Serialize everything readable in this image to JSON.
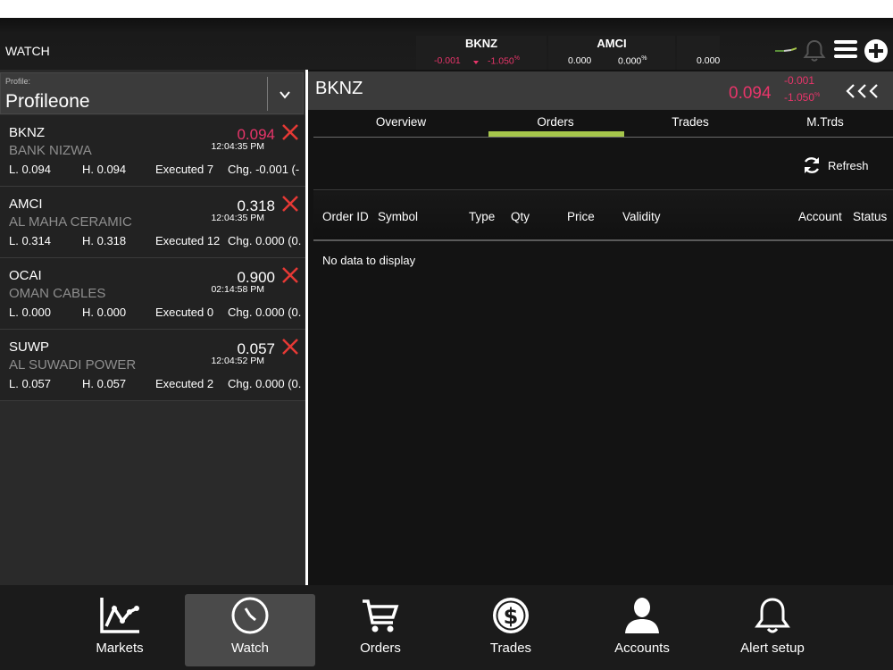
{
  "header": {
    "title": "WATCH",
    "tickers": [
      {
        "symbol": "BKNZ",
        "change": "-0.001",
        "pct": "-1.050",
        "pct_unit": "%"
      },
      {
        "symbol": "AMCI",
        "change": "0.000",
        "pct": "0.000",
        "pct_unit": "%"
      },
      {
        "symbol": "",
        "change": "0.000",
        "pct": "",
        "pct_unit": ""
      }
    ],
    "icons": [
      "mini-chart-icon",
      "bell-icon",
      "menu-icon",
      "add-icon"
    ]
  },
  "profile": {
    "caption": "Profile:",
    "name": "Profileone"
  },
  "watchlist": [
    {
      "symbol": "BKNZ",
      "name": "BANK NIZWA",
      "price": "0.094",
      "price_color": "#e8356a",
      "time": "12:04:35 PM",
      "low": "L. 0.094",
      "high": "H. 0.094",
      "executed": "Executed 7",
      "change": "Chg. -0.001 (-"
    },
    {
      "symbol": "AMCI",
      "name": "AL MAHA CERAMIC",
      "price": "0.318",
      "price_color": "#ffffff",
      "time": "12:04:35 PM",
      "low": "L. 0.314",
      "high": "H. 0.318",
      "executed": "Executed 12",
      "change": "Chg. 0.000 (0."
    },
    {
      "symbol": "OCAI",
      "name": "OMAN CABLES",
      "price": "0.900",
      "price_color": "#ffffff",
      "time": "02:14:58 PM",
      "low": "L. 0.000",
      "high": "H. 0.000",
      "executed": "Executed 0",
      "change": "Chg. 0.000 (0."
    },
    {
      "symbol": "SUWP",
      "name": "AL SUWADI POWER",
      "price": "0.057",
      "price_color": "#ffffff",
      "time": "12:04:52 PM",
      "low": "L. 0.057",
      "high": "H. 0.057",
      "executed": "Executed 2",
      "change": "Chg. 0.000 (0."
    }
  ],
  "detail": {
    "symbol": "BKNZ",
    "price": "0.094",
    "change": "-0.001",
    "pct": "-1.050",
    "pct_unit": "%",
    "tabs": [
      "Overview",
      "Orders",
      "Trades",
      "M.Trds"
    ],
    "active_tab": "Orders",
    "refresh_label": "Refresh",
    "columns": [
      "Order ID",
      "Symbol",
      "Type",
      "Qty",
      "Price",
      "Validity",
      "Account",
      "Status"
    ],
    "empty_message": "No data to display"
  },
  "nav": {
    "items": [
      {
        "label": "Markets",
        "icon": "line-chart-icon"
      },
      {
        "label": "Watch",
        "icon": "clock-icon"
      },
      {
        "label": "Orders",
        "icon": "cart-icon"
      },
      {
        "label": "Trades",
        "icon": "dollar-icon"
      },
      {
        "label": "Accounts",
        "icon": "user-icon"
      },
      {
        "label": "Alert setup",
        "icon": "bell-icon"
      }
    ],
    "active": "Watch"
  },
  "colors": {
    "negative": "#e8356a",
    "accent": "#a6c64b",
    "close": "#e53935"
  }
}
